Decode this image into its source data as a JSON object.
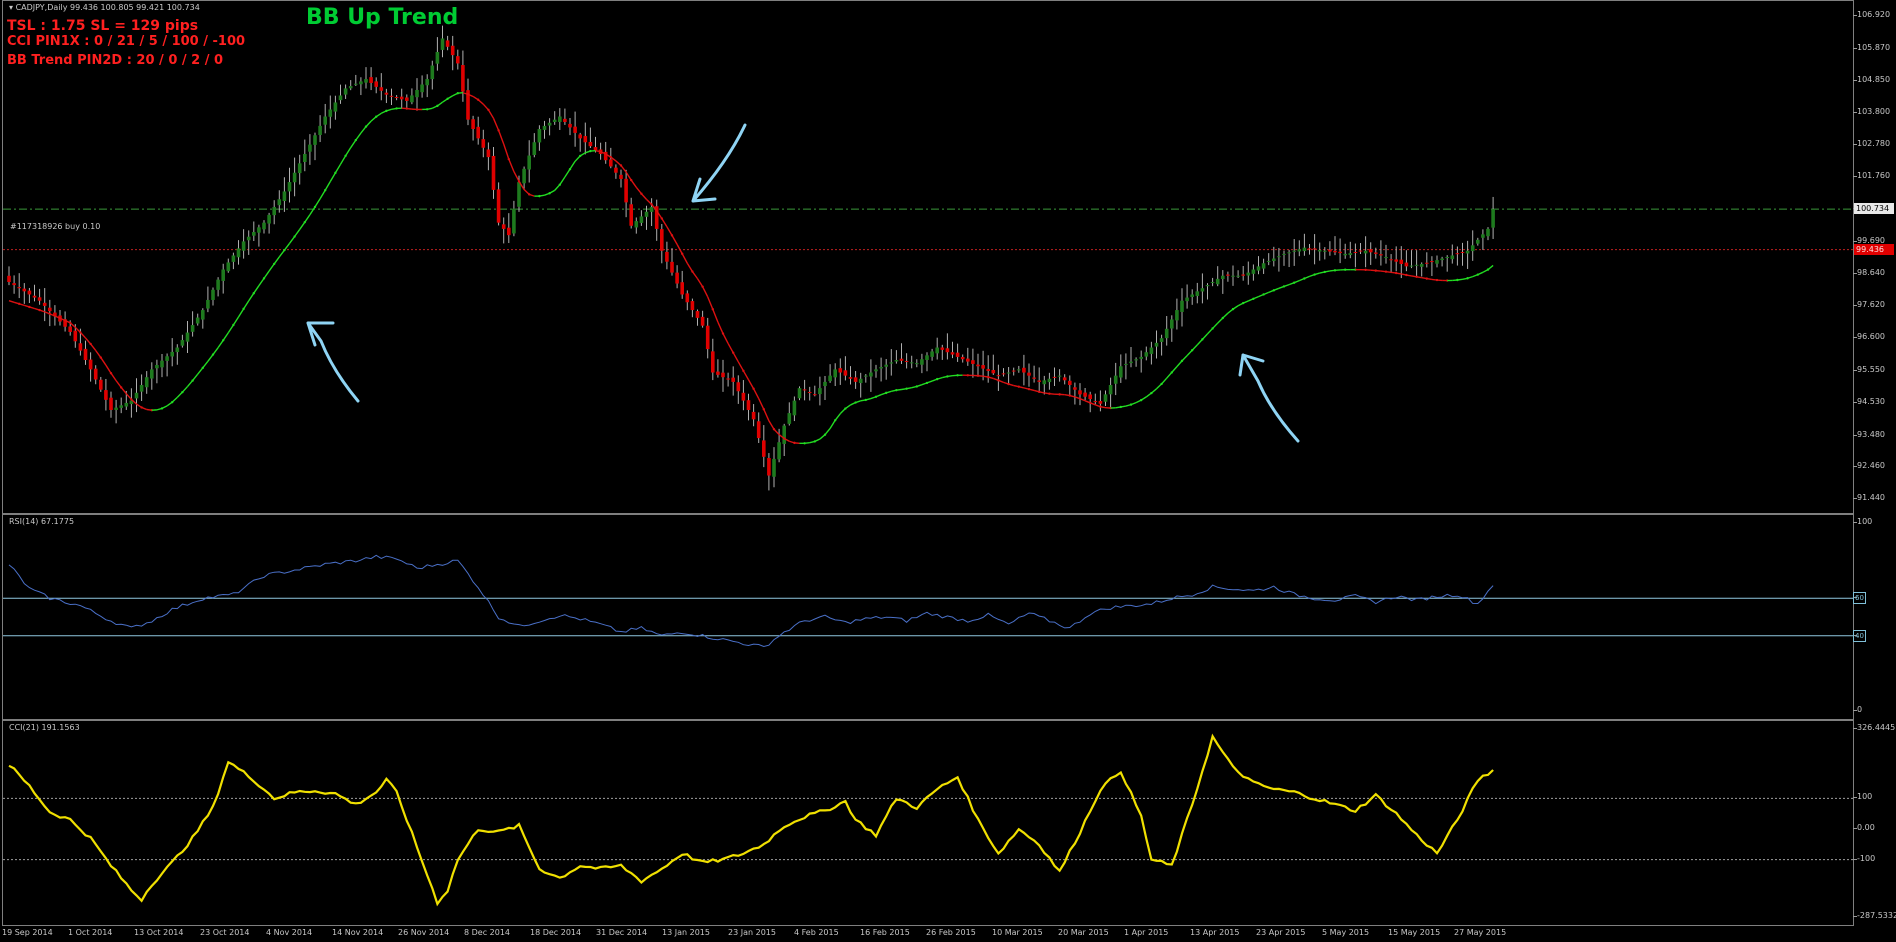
{
  "header": {
    "symbol_line": "CADJPY,Daily  99.436 100.805 99.421 100.734",
    "title": "BB Up Trend",
    "tsl_line": "TSL : 1.75   SL = 129 pips",
    "cci_line": "CCI PIN1X : 0 / 21 / 5 / 100 / -100",
    "bb_line": "BB Trend PIN2D : 20 / 0 / 2 / 0"
  },
  "order": {
    "label": "#117318926 buy 0.10",
    "price": 100.734,
    "entry": 99.436
  },
  "colors": {
    "bull": "#1e7a1e",
    "bear": "#e00000",
    "wick": "#b0b0b0",
    "trend_up": "#22dd22",
    "trend_down": "#dd1111",
    "rsi": "#4a70c8",
    "cci": "#f0e000",
    "level": "#8fc8e0",
    "annotation_arrow": "#8fd4f4"
  },
  "price_axis": {
    "labels": [
      "106.920",
      "105.870",
      "104.850",
      "103.800",
      "102.780",
      "101.760",
      "100.734",
      "99.690",
      "98.640",
      "97.620",
      "96.600",
      "95.550",
      "94.530",
      "93.480",
      "92.460",
      "91.440"
    ],
    "current": "100.734",
    "entry": "99.436"
  },
  "rsi": {
    "title": "RSI(14) 67.1775",
    "axis_labels": [
      "100",
      "60",
      "40",
      "0"
    ],
    "levels": [
      60,
      40
    ]
  },
  "cci": {
    "title": "CCI(21) 191.1563",
    "axis_labels": [
      "326.4445",
      "100",
      "0.00",
      "-100",
      "-287.5332"
    ],
    "levels": [
      100,
      -100
    ]
  },
  "time_axis": {
    "labels": [
      "19 Sep 2014",
      "1 Oct 2014",
      "13 Oct 2014",
      "23 Oct 2014",
      "4 Nov 2014",
      "14 Nov 2014",
      "26 Nov 2014",
      "8 Dec 2014",
      "18 Dec 2014",
      "31 Dec 2014",
      "13 Jan 2015",
      "23 Jan 2015",
      "4 Feb 2015",
      "16 Feb 2015",
      "26 Feb 2015",
      "10 Mar 2015",
      "20 Mar 2015",
      "1 Apr 2015",
      "13 Apr 2015",
      "23 Apr 2015",
      "5 May 2015",
      "15 May 2015",
      "27 May 2015"
    ]
  },
  "chart_data": [
    {
      "type": "candlestick",
      "title": "CADJPY,Daily",
      "ylim": [
        91.0,
        107.4
      ],
      "close_keypoints": [
        [
          0,
          98.4
        ],
        [
          6,
          97.8
        ],
        [
          12,
          96.8
        ],
        [
          16,
          95.6
        ],
        [
          20,
          94.3
        ],
        [
          24,
          94.6
        ],
        [
          28,
          95.6
        ],
        [
          33,
          96.3
        ],
        [
          38,
          97.5
        ],
        [
          42,
          98.8
        ],
        [
          46,
          99.7
        ],
        [
          50,
          100.3
        ],
        [
          54,
          101.3
        ],
        [
          58,
          102.5
        ],
        [
          62,
          103.7
        ],
        [
          66,
          104.6
        ],
        [
          70,
          104.9
        ],
        [
          74,
          104.4
        ],
        [
          78,
          104.2
        ],
        [
          82,
          104.9
        ],
        [
          85,
          106.2
        ],
        [
          88,
          105.4
        ],
        [
          90,
          103.6
        ],
        [
          94,
          102.4
        ],
        [
          96,
          100.3
        ],
        [
          98,
          99.9
        ],
        [
          100,
          101.6
        ],
        [
          104,
          103.3
        ],
        [
          108,
          103.7
        ],
        [
          112,
          103.0
        ],
        [
          116,
          102.5
        ],
        [
          120,
          101.7
        ],
        [
          122,
          100.2
        ],
        [
          126,
          100.8
        ],
        [
          128,
          99.4
        ],
        [
          132,
          98.0
        ],
        [
          136,
          97.0
        ],
        [
          138,
          95.5
        ],
        [
          142,
          95.2
        ],
        [
          146,
          94.0
        ],
        [
          149,
          92.2
        ],
        [
          152,
          93.8
        ],
        [
          155,
          95.0
        ],
        [
          158,
          94.8
        ],
        [
          162,
          95.6
        ],
        [
          166,
          95.2
        ],
        [
          170,
          95.6
        ],
        [
          174,
          95.9
        ],
        [
          178,
          95.8
        ],
        [
          182,
          96.3
        ],
        [
          186,
          96.0
        ],
        [
          190,
          95.7
        ],
        [
          194,
          95.4
        ],
        [
          198,
          95.6
        ],
        [
          202,
          95.2
        ],
        [
          206,
          95.4
        ],
        [
          210,
          94.8
        ],
        [
          214,
          94.5
        ],
        [
          218,
          95.7
        ],
        [
          222,
          96.0
        ],
        [
          226,
          96.6
        ],
        [
          230,
          97.8
        ],
        [
          234,
          98.2
        ],
        [
          238,
          98.6
        ],
        [
          242,
          98.6
        ],
        [
          246,
          99.0
        ],
        [
          250,
          99.3
        ],
        [
          254,
          99.5
        ],
        [
          258,
          99.4
        ],
        [
          262,
          99.3
        ],
        [
          266,
          99.4
        ],
        [
          270,
          99.2
        ],
        [
          274,
          98.9
        ],
        [
          278,
          99.0
        ],
        [
          282,
          99.2
        ],
        [
          286,
          99.4
        ],
        [
          290,
          100.1
        ],
        [
          291,
          100.734
        ]
      ]
    },
    {
      "type": "line",
      "title": "RSI(14) 67.1775",
      "ylim": [
        0,
        100
      ],
      "values_keypoints": [
        [
          0,
          78
        ],
        [
          4,
          65
        ],
        [
          8,
          60
        ],
        [
          14,
          56
        ],
        [
          20,
          48
        ],
        [
          24,
          44
        ],
        [
          28,
          48
        ],
        [
          32,
          54
        ],
        [
          38,
          60
        ],
        [
          44,
          62
        ],
        [
          50,
          72
        ],
        [
          56,
          75
        ],
        [
          62,
          78
        ],
        [
          68,
          80
        ],
        [
          72,
          82
        ],
        [
          76,
          81
        ],
        [
          80,
          76
        ],
        [
          84,
          78
        ],
        [
          88,
          80
        ],
        [
          92,
          66
        ],
        [
          96,
          50
        ],
        [
          100,
          45
        ],
        [
          104,
          48
        ],
        [
          108,
          51
        ],
        [
          112,
          49
        ],
        [
          116,
          46
        ],
        [
          120,
          42
        ],
        [
          124,
          44
        ],
        [
          128,
          40
        ],
        [
          132,
          42
        ],
        [
          136,
          40
        ],
        [
          140,
          38
        ],
        [
          144,
          36
        ],
        [
          148,
          34
        ],
        [
          152,
          42
        ],
        [
          156,
          48
        ],
        [
          160,
          50
        ],
        [
          164,
          47
        ],
        [
          168,
          49
        ],
        [
          172,
          50
        ],
        [
          176,
          48
        ],
        [
          180,
          52
        ],
        [
          184,
          50
        ],
        [
          188,
          48
        ],
        [
          192,
          51
        ],
        [
          196,
          46
        ],
        [
          200,
          52
        ],
        [
          204,
          48
        ],
        [
          208,
          44
        ],
        [
          212,
          52
        ],
        [
          216,
          55
        ],
        [
          220,
          56
        ],
        [
          224,
          57
        ],
        [
          228,
          60
        ],
        [
          232,
          62
        ],
        [
          236,
          66
        ],
        [
          240,
          65
        ],
        [
          244,
          64
        ],
        [
          248,
          66
        ],
        [
          252,
          62
        ],
        [
          256,
          60
        ],
        [
          260,
          59
        ],
        [
          264,
          61
        ],
        [
          268,
          58
        ],
        [
          272,
          61
        ],
        [
          276,
          59
        ],
        [
          280,
          61
        ],
        [
          284,
          62
        ],
        [
          288,
          57
        ],
        [
          291,
          67.18
        ]
      ]
    },
    {
      "type": "line",
      "title": "CCI(21) 191.1563",
      "ylim": [
        -287.5332,
        326.4445
      ],
      "values_keypoints": [
        [
          0,
          210
        ],
        [
          4,
          140
        ],
        [
          8,
          55
        ],
        [
          12,
          30
        ],
        [
          16,
          -30
        ],
        [
          20,
          -120
        ],
        [
          24,
          -200
        ],
        [
          26,
          -230
        ],
        [
          28,
          -180
        ],
        [
          32,
          -110
        ],
        [
          36,
          -30
        ],
        [
          40,
          70
        ],
        [
          43,
          220
        ],
        [
          48,
          160
        ],
        [
          52,
          100
        ],
        [
          56,
          120
        ],
        [
          60,
          125
        ],
        [
          64,
          115
        ],
        [
          68,
          80
        ],
        [
          72,
          120
        ],
        [
          74,
          160
        ],
        [
          76,
          120
        ],
        [
          80,
          -60
        ],
        [
          84,
          -240
        ],
        [
          86,
          -200
        ],
        [
          88,
          -100
        ],
        [
          92,
          0
        ],
        [
          96,
          -10
        ],
        [
          100,
          10
        ],
        [
          104,
          -130
        ],
        [
          108,
          -160
        ],
        [
          112,
          -120
        ],
        [
          116,
          -130
        ],
        [
          120,
          -120
        ],
        [
          124,
          -170
        ],
        [
          128,
          -130
        ],
        [
          132,
          -80
        ],
        [
          136,
          -110
        ],
        [
          140,
          -100
        ],
        [
          144,
          -80
        ],
        [
          148,
          -50
        ],
        [
          152,
          10
        ],
        [
          156,
          40
        ],
        [
          160,
          60
        ],
        [
          164,
          90
        ],
        [
          166,
          30
        ],
        [
          170,
          -20
        ],
        [
          174,
          100
        ],
        [
          178,
          70
        ],
        [
          182,
          130
        ],
        [
          186,
          170
        ],
        [
          190,
          30
        ],
        [
          194,
          -80
        ],
        [
          198,
          0
        ],
        [
          202,
          -50
        ],
        [
          206,
          -140
        ],
        [
          210,
          -10
        ],
        [
          214,
          130
        ],
        [
          218,
          190
        ],
        [
          222,
          40
        ],
        [
          224,
          -100
        ],
        [
          228,
          -120
        ],
        [
          232,
          80
        ],
        [
          236,
          300
        ],
        [
          240,
          200
        ],
        [
          244,
          150
        ],
        [
          248,
          130
        ],
        [
          252,
          120
        ],
        [
          256,
          100
        ],
        [
          260,
          80
        ],
        [
          264,
          60
        ],
        [
          268,
          110
        ],
        [
          272,
          50
        ],
        [
          276,
          -20
        ],
        [
          280,
          -80
        ],
        [
          284,
          30
        ],
        [
          288,
          160
        ],
        [
          291,
          191.16
        ]
      ]
    }
  ]
}
